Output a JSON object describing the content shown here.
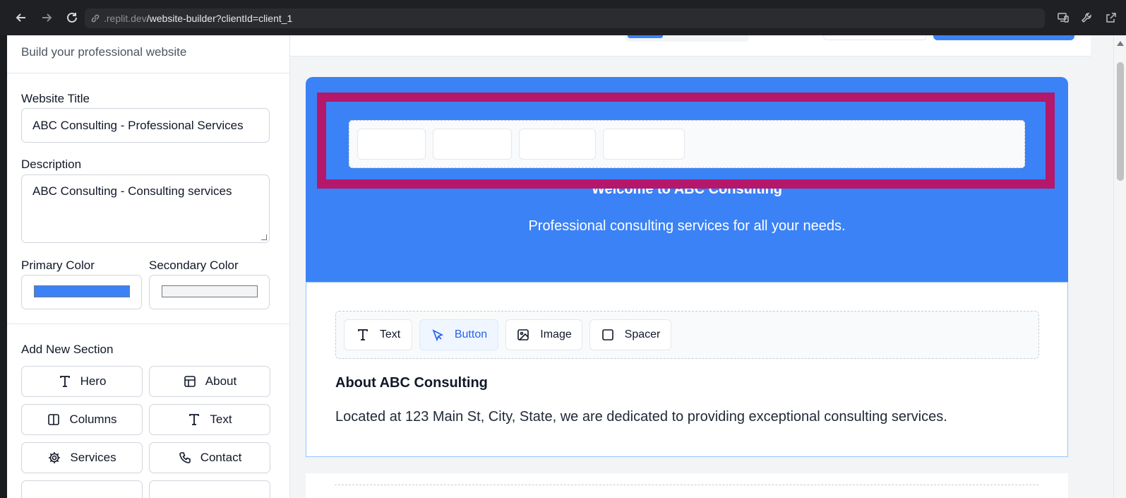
{
  "browser": {
    "url_host": ".replit.dev",
    "url_path": "/website-builder?clientId=client_1"
  },
  "sidebar": {
    "subtitle": "Build your professional website",
    "website_title_label": "Website Title",
    "website_title_value": "ABC Consulting - Professional Services",
    "description_label": "Description",
    "description_value": "ABC Consulting - Consulting services",
    "primary_color_label": "Primary Color",
    "primary_color": "#3b82f6",
    "secondary_color_label": "Secondary Color",
    "secondary_color": "#f3f4f6",
    "add_section_label": "Add New Section",
    "section_buttons": [
      {
        "label": "Hero",
        "icon": "text-type-icon"
      },
      {
        "label": "About",
        "icon": "layout-icon"
      },
      {
        "label": "Columns",
        "icon": "columns-icon"
      },
      {
        "label": "Text",
        "icon": "text-type-icon"
      },
      {
        "label": "Services",
        "icon": "gear-icon"
      },
      {
        "label": "Contact",
        "icon": "phone-icon"
      }
    ]
  },
  "canvas": {
    "hero": {
      "heading": "Welcome to ABC Consulting",
      "subtitle": "Professional consulting services for all your needs."
    },
    "about": {
      "element_buttons": [
        {
          "label": "Text",
          "icon": "text-type-icon"
        },
        {
          "label": "Button",
          "icon": "cursor-pointer-icon"
        },
        {
          "label": "Image",
          "icon": "image-icon"
        },
        {
          "label": "Spacer",
          "icon": "square-icon"
        }
      ],
      "title": "About ABC Consulting",
      "body": "Located at 123 Main St, City, State, we are dedicated to providing exceptional consulting services."
    }
  }
}
